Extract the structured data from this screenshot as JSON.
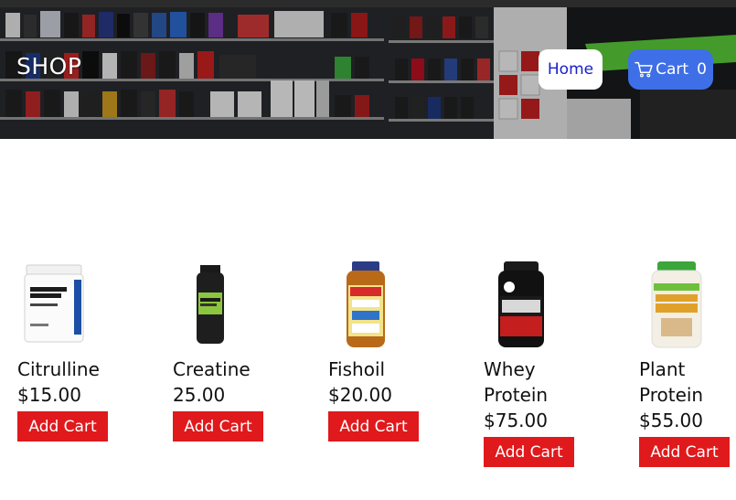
{
  "header": {
    "title": "SHOP",
    "home_label": "Home",
    "cart_label": "Cart",
    "cart_count": "0"
  },
  "colors": {
    "accent": "#3f6fe6",
    "add_button": "#e0191c",
    "home_text": "#1a20c8"
  },
  "products": [
    {
      "name": "Citrulline",
      "price": "$15.00",
      "button": "Add Cart",
      "icon": "citrulline-tub-icon"
    },
    {
      "name": "Creatine",
      "price": "25.00",
      "button": "Add Cart",
      "icon": "creatine-bottle-icon"
    },
    {
      "name": "Fishoil",
      "price": "$20.00",
      "button": "Add Cart",
      "icon": "fishoil-bottle-icon"
    },
    {
      "name": "Whey Protein",
      "price": "$75.00",
      "button": "Add Cart",
      "icon": "whey-tub-icon"
    },
    {
      "name": "Plant Protein",
      "price": "$55.00",
      "button": "Add Cart",
      "icon": "plant-protein-tub-icon"
    }
  ]
}
